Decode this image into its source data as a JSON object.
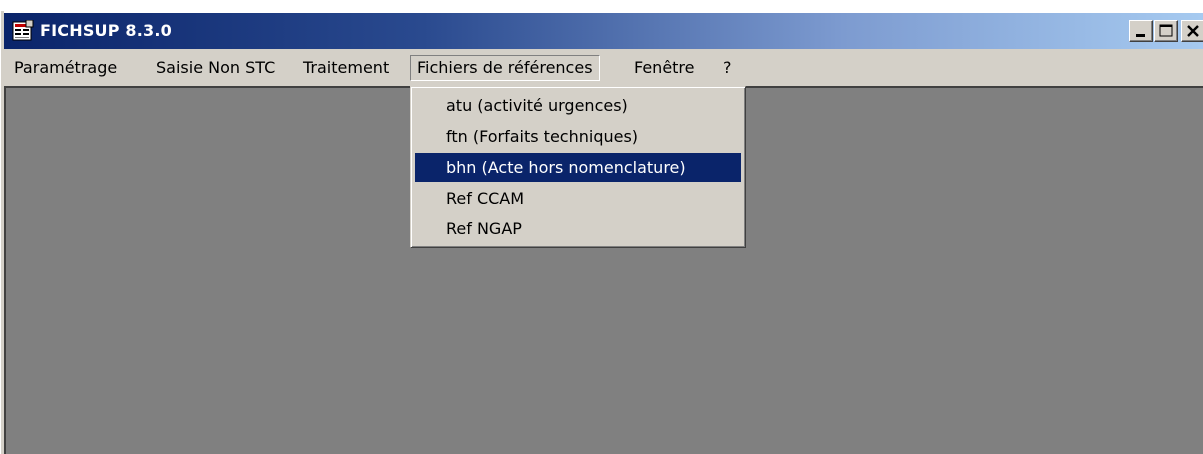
{
  "window": {
    "title": "FICHSUP 8.3.0",
    "controls": {
      "minimize_icon": "minimize-icon",
      "maximize_icon": "maximize-icon",
      "close_icon": "close-icon"
    }
  },
  "menubar": {
    "items": [
      {
        "label": "Paramétrage"
      },
      {
        "label": "Saisie Non STC"
      },
      {
        "label": "Traitement"
      },
      {
        "label": "Fichiers de références",
        "open": true
      },
      {
        "label": "Fenêtre"
      },
      {
        "label": "?"
      }
    ]
  },
  "dropdown": {
    "items": [
      {
        "label": "atu (activité urgences)"
      },
      {
        "label": "ftn (Forfaits techniques)"
      },
      {
        "label": "bhn (Acte hors nomenclature)",
        "highlighted": true
      },
      {
        "label": "Ref CCAM"
      },
      {
        "label": "Ref NGAP"
      }
    ]
  },
  "colors": {
    "title_bar_start": "#0a246a",
    "title_bar_end": "#a6caf0",
    "menu_background": "#d4d0c8",
    "client_area": "#808080",
    "highlight": "#0a246a"
  }
}
